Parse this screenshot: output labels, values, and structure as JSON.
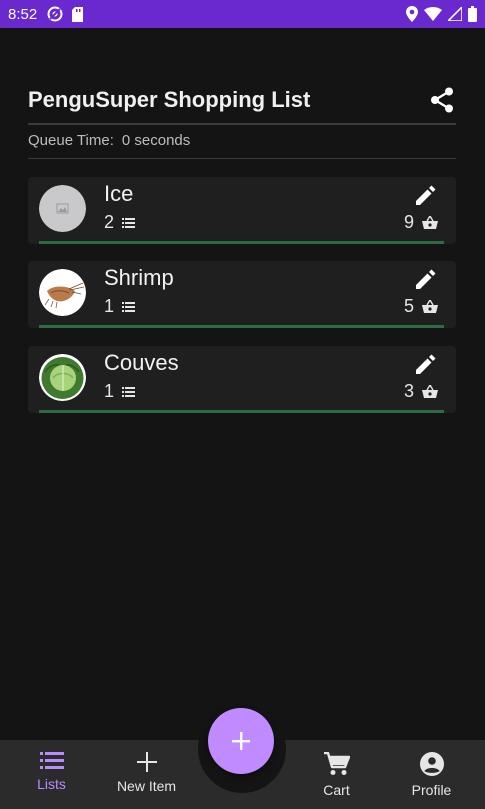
{
  "status_bar": {
    "time": "8:52",
    "left_icons": [
      "vpn-icon",
      "sd-card-icon"
    ],
    "right_icons": [
      "location-icon",
      "wifi-icon",
      "signal-icon",
      "battery-icon"
    ]
  },
  "header": {
    "title": "PenguSuper Shopping List",
    "share_icon": "share-icon"
  },
  "queue": {
    "label": "Queue Time:",
    "value": "0 seconds"
  },
  "items": [
    {
      "name": "Ice",
      "list_count": "2",
      "cart_count": "9",
      "image": "placeholder-image"
    },
    {
      "name": "Shrimp",
      "list_count": "1",
      "cart_count": "5",
      "image": "shrimp-image"
    },
    {
      "name": "Couves",
      "list_count": "1",
      "cart_count": "3",
      "image": "cabbage-image"
    }
  ],
  "bottom_nav": {
    "items": [
      {
        "label": "Lists",
        "icon": "list-icon",
        "active": true
      },
      {
        "label": "New Item",
        "icon": "plus-icon",
        "active": false
      },
      {
        "label": "Cart",
        "icon": "cart-icon",
        "active": false
      },
      {
        "label": "Profile",
        "icon": "account-icon",
        "active": false
      }
    ],
    "fab_icon": "plus-icon"
  },
  "colors": {
    "status_bar": "#6a29ce",
    "background": "#141414",
    "card": "#1f1f1f",
    "progress": "#2e6a44",
    "accent": "#b88cff",
    "fab": "#c08bff"
  }
}
